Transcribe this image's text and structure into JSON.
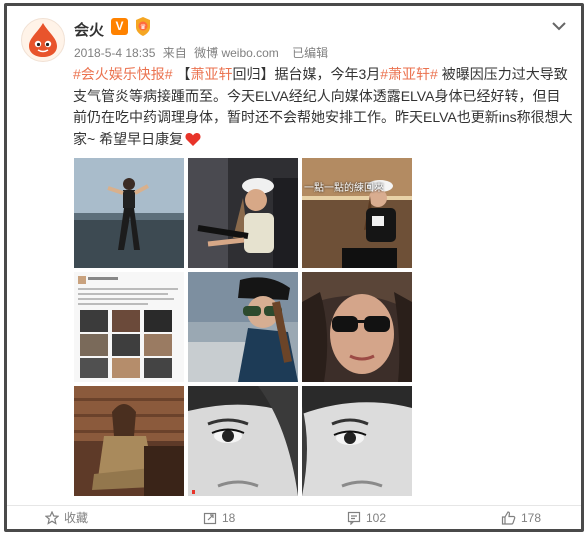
{
  "user": {
    "name": "会火",
    "vip_badge": "V",
    "avatar_icon": "fire-drop-icon"
  },
  "post": {
    "date": "2018-5-4 18:35",
    "source_prefix": "来自",
    "source": "微博 weibo.com",
    "edited": "已编辑",
    "topic": "#会火娱乐快报#",
    "headline_open": "【",
    "headline_name": "萧亚轩",
    "headline_rest": "回归】",
    "text_1": "据台媒，今年3月",
    "mention_topic": "#萧亚轩#",
    "text_2": " 被曝因压力过大导致支气管炎等病接踵而至。今天ELVA经纪人向媒体透露ELVA身体已经好转，但目前仍在吃中药调理身体，暂时还不会帮她安排工作。昨天ELVA也更新ins称很想大家~ 希望早日康复"
  },
  "photos": [
    {
      "name": "photo-yoga-seaside",
      "caption": ""
    },
    {
      "name": "photo-gym-cap",
      "caption": ""
    },
    {
      "name": "photo-studio-cap",
      "caption": "一點一點的練回來"
    },
    {
      "name": "photo-screenshot-collage",
      "caption": ""
    },
    {
      "name": "photo-sunglasses-cap",
      "caption": ""
    },
    {
      "name": "photo-sunglasses-selfie",
      "caption": ""
    },
    {
      "name": "photo-sitting-room",
      "caption": ""
    },
    {
      "name": "photo-bw-closeup-1",
      "caption": ""
    },
    {
      "name": "photo-bw-closeup-2",
      "caption": ""
    }
  ],
  "footer": {
    "favorite_label": "收藏",
    "repost_count": "18",
    "comment_count": "102",
    "like_count": "178"
  },
  "colors": {
    "accent": "#eb7350",
    "vip": "#ff8200",
    "text": "#333333",
    "meta": "#808080"
  }
}
